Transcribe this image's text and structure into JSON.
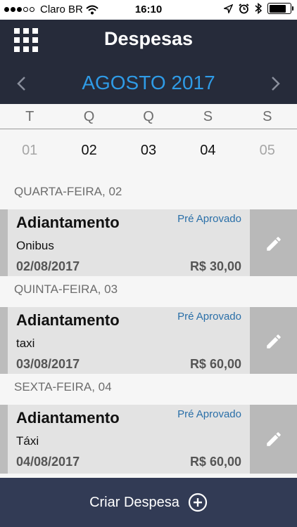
{
  "status_bar": {
    "carrier": "Claro BR",
    "time": "16:10"
  },
  "header": {
    "title": "Despesas",
    "month": "AGOSTO 2017",
    "menu_icon": "grid-menu-icon",
    "prev_icon": "chevron-left-icon",
    "next_icon": "chevron-right-icon",
    "accent_color": "#2f9be6",
    "bg_color": "#262b3a"
  },
  "week": {
    "days": [
      "T",
      "Q",
      "Q",
      "S",
      "S"
    ],
    "dates": [
      "01",
      "02",
      "03",
      "04",
      "05"
    ]
  },
  "sections": [
    {
      "header": "QUARTA-FEIRA, 02",
      "expense": {
        "type": "Adiantamento",
        "status": "Pré Aprovado",
        "description": "Onibus",
        "date": "02/08/2017",
        "amount": "R$ 30,00"
      }
    },
    {
      "header": "QUINTA-FEIRA, 03",
      "expense": {
        "type": "Adiantamento",
        "status": "Pré Aprovado",
        "description": "taxi",
        "date": "03/08/2017",
        "amount": "R$ 60,00"
      }
    },
    {
      "header": "SEXTA-FEIRA, 04",
      "expense": {
        "type": "Adiantamento",
        "status": "Pré Aprovado",
        "description": "Táxi",
        "date": "04/08/2017",
        "amount": "R$ 60,00"
      }
    }
  ],
  "bottom_bar": {
    "label": "Criar Despesa",
    "icon": "plus-circle-icon",
    "bg_color": "#323b55"
  }
}
